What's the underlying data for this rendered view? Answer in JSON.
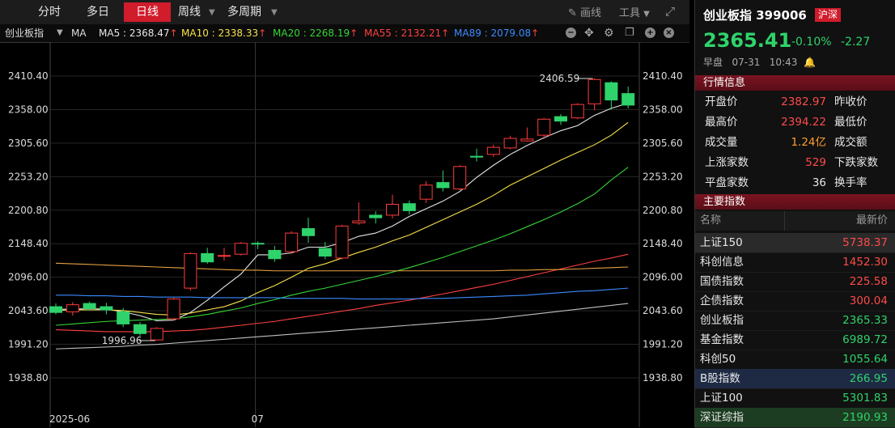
{
  "tabs": [
    {
      "label": "分时",
      "active": false,
      "caret": false
    },
    {
      "label": "多日",
      "active": false,
      "caret": false
    },
    {
      "label": "日线",
      "active": true,
      "caret": false
    },
    {
      "label": "周线",
      "active": false,
      "caret": true
    },
    {
      "label": "多周期",
      "active": false,
      "caret": true
    }
  ],
  "tools": {
    "draw": "画线",
    "tools": "工具"
  },
  "ma_bar": {
    "name": "创业板指",
    "ma": "MA",
    "items": [
      {
        "text": "MA5 : 2368.47",
        "color": "#e6e6e6"
      },
      {
        "text": "MA10 : 2338.33",
        "color": "#f5e04a"
      },
      {
        "text": "MA20 : 2268.19",
        "color": "#35d535"
      },
      {
        "text": "MA55 : 2132.21",
        "color": "#ff4040"
      },
      {
        "text": "MA89 : 2079.08",
        "color": "#3b8bff"
      }
    ],
    "arrow": "↑"
  },
  "chart_data": {
    "type": "candlestick",
    "y_ticks": [
      2410.4,
      2358.0,
      2305.6,
      2253.2,
      2200.8,
      2148.4,
      2096.0,
      2043.6,
      1991.2,
      1938.8
    ],
    "x_labels": [
      {
        "label": "2025-06",
        "index": 0
      },
      {
        "label": "07",
        "index": 12
      }
    ],
    "annotations": {
      "high": "2406.59",
      "low": "1996.96"
    },
    "candles": [
      {
        "o": 2050,
        "h": 2055,
        "l": 2038,
        "c": 2041
      },
      {
        "o": 2042,
        "h": 2057,
        "l": 2036,
        "c": 2053
      },
      {
        "o": 2055,
        "h": 2058,
        "l": 2044,
        "c": 2047
      },
      {
        "o": 2050,
        "h": 2056,
        "l": 2038,
        "c": 2045
      },
      {
        "o": 2042,
        "h": 2048,
        "l": 2018,
        "c": 2023
      },
      {
        "o": 2022,
        "h": 2026,
        "l": 2004,
        "c": 2008
      },
      {
        "o": 1998,
        "h": 2018,
        "l": 1997,
        "c": 2016
      },
      {
        "o": 2031,
        "h": 2064,
        "l": 2028,
        "c": 2062
      },
      {
        "o": 2079,
        "h": 2135,
        "l": 2075,
        "c": 2133
      },
      {
        "o": 2133,
        "h": 2142,
        "l": 2117,
        "c": 2120
      },
      {
        "o": 2129,
        "h": 2142,
        "l": 2122,
        "c": 2130
      },
      {
        "o": 2132,
        "h": 2151,
        "l": 2130,
        "c": 2149
      },
      {
        "o": 2149,
        "h": 2152,
        "l": 2140,
        "c": 2148
      },
      {
        "o": 2138,
        "h": 2145,
        "l": 2120,
        "c": 2125
      },
      {
        "o": 2136,
        "h": 2168,
        "l": 2133,
        "c": 2165
      },
      {
        "o": 2172,
        "h": 2189,
        "l": 2150,
        "c": 2161
      },
      {
        "o": 2141,
        "h": 2151,
        "l": 2124,
        "c": 2129
      },
      {
        "o": 2126,
        "h": 2178,
        "l": 2124,
        "c": 2176
      },
      {
        "o": 2181,
        "h": 2213,
        "l": 2178,
        "c": 2184
      },
      {
        "o": 2193,
        "h": 2199,
        "l": 2180,
        "c": 2189
      },
      {
        "o": 2193,
        "h": 2225,
        "l": 2188,
        "c": 2210
      },
      {
        "o": 2211,
        "h": 2216,
        "l": 2194,
        "c": 2200
      },
      {
        "o": 2218,
        "h": 2246,
        "l": 2212,
        "c": 2240
      },
      {
        "o": 2244,
        "h": 2263,
        "l": 2230,
        "c": 2236
      },
      {
        "o": 2234,
        "h": 2271,
        "l": 2232,
        "c": 2269
      },
      {
        "o": 2285,
        "h": 2297,
        "l": 2277,
        "c": 2284
      },
      {
        "o": 2288,
        "h": 2303,
        "l": 2284,
        "c": 2299
      },
      {
        "o": 2298,
        "h": 2317,
        "l": 2296,
        "c": 2313
      },
      {
        "o": 2309,
        "h": 2330,
        "l": 2308,
        "c": 2312
      },
      {
        "o": 2318,
        "h": 2345,
        "l": 2312,
        "c": 2343
      },
      {
        "o": 2347,
        "h": 2351,
        "l": 2334,
        "c": 2340
      },
      {
        "o": 2345,
        "h": 2368,
        "l": 2343,
        "c": 2366
      },
      {
        "o": 2367,
        "h": 2407,
        "l": 2357,
        "c": 2405
      },
      {
        "o": 2400,
        "h": 2402,
        "l": 2358,
        "c": 2373
      },
      {
        "o": 2383,
        "h": 2394,
        "l": 2360,
        "c": 2365
      }
    ],
    "ma_series": [
      {
        "name": "MA5",
        "color": "#e6e6e6",
        "values": [
          2046,
          2046,
          2047,
          2046,
          2042,
          2036,
          2028,
          2029,
          2041,
          2060,
          2081,
          2101,
          2131,
          2131,
          2134,
          2143,
          2143,
          2150,
          2160,
          2165,
          2176,
          2191,
          2203,
          2215,
          2230,
          2252,
          2271,
          2288,
          2302,
          2314,
          2325,
          2333,
          2349,
          2360,
          2368
        ]
      },
      {
        "name": "MA10",
        "color": "#f5e04a",
        "values": [
          2044,
          2045,
          2045,
          2045,
          2044,
          2041,
          2038,
          2037,
          2040,
          2045,
          2050,
          2059,
          2072,
          2083,
          2096,
          2110,
          2117,
          2126,
          2135,
          2143,
          2153,
          2162,
          2174,
          2186,
          2198,
          2210,
          2224,
          2240,
          2253,
          2266,
          2279,
          2291,
          2303,
          2318,
          2338
        ]
      },
      {
        "name": "MA20",
        "color": "#35d535",
        "values": [
          2021,
          2023,
          2025,
          2027,
          2028,
          2029,
          2030,
          2031,
          2034,
          2038,
          2043,
          2048,
          2055,
          2061,
          2068,
          2074,
          2079,
          2085,
          2091,
          2097,
          2104,
          2111,
          2119,
          2127,
          2136,
          2145,
          2154,
          2164,
          2175,
          2186,
          2198,
          2211,
          2226,
          2248,
          2268
        ]
      },
      {
        "name": "MA55",
        "color": "#ff4040",
        "values": [
          2014,
          2013,
          2012,
          2011,
          2011,
          2011,
          2011,
          2012,
          2013,
          2015,
          2018,
          2021,
          2024,
          2027,
          2031,
          2035,
          2039,
          2043,
          2047,
          2052,
          2056,
          2060,
          2065,
          2070,
          2075,
          2080,
          2085,
          2091,
          2097,
          2103,
          2109,
          2115,
          2121,
          2126,
          2132
        ]
      },
      {
        "name": "MA89",
        "color": "#3b8bff",
        "values": [
          2068,
          2068,
          2067,
          2067,
          2066,
          2066,
          2065,
          2065,
          2065,
          2064,
          2064,
          2064,
          2064,
          2064,
          2063,
          2063,
          2063,
          2063,
          2062,
          2062,
          2062,
          2062,
          2063,
          2063,
          2064,
          2065,
          2066,
          2067,
          2068,
          2070,
          2072,
          2074,
          2075,
          2077,
          2079
        ]
      },
      {
        "name": "",
        "color": "#e6a040",
        "values": [
          2118,
          2117,
          2116,
          2115,
          2114,
          2113,
          2112,
          2111,
          2110,
          2109,
          2108,
          2107,
          2107,
          2106,
          2106,
          2106,
          2106,
          2106,
          2106,
          2106,
          2106,
          2106,
          2106,
          2106,
          2106,
          2106,
          2106,
          2107,
          2107,
          2108,
          2108,
          2109,
          2110,
          2111,
          2112
        ]
      },
      {
        "name": "",
        "color": "#bfbfbf",
        "values": [
          1984,
          1985,
          1986,
          1987,
          1988,
          1990,
          1991,
          1993,
          1995,
          1997,
          1999,
          2001,
          2003,
          2005,
          2007,
          2009,
          2011,
          2013,
          2015,
          2017,
          2019,
          2021,
          2023,
          2025,
          2027,
          2029,
          2031,
          2034,
          2037,
          2040,
          2043,
          2046,
          2049,
          2052,
          2055
        ]
      }
    ]
  },
  "quote": {
    "title": "创业板指 399006",
    "market": "沪深",
    "price": "2365.41",
    "change_pct": "-0.10%",
    "change": "-2.27",
    "session": "早盘",
    "date": "07-31",
    "time": "10:43"
  },
  "sections": {
    "quote": "行情信息",
    "index": "主要指数"
  },
  "quote_rows": [
    {
      "l1": "开盘价",
      "v1": "2382.97",
      "c1": "red",
      "l2": "昨收价"
    },
    {
      "l1": "最高价",
      "v1": "2394.22",
      "c1": "red",
      "l2": "最低价"
    },
    {
      "l1": "成交量",
      "v1": "1.24亿",
      "c1": "orange",
      "l2": "成交额"
    },
    {
      "l1": "上涨家数",
      "v1": "529",
      "c1": "red",
      "l2": "下跌家数"
    },
    {
      "l1": "平盘家数",
      "v1": "36",
      "c1": "white",
      "l2": "换手率"
    }
  ],
  "index_header": {
    "name": "名称",
    "value": "最新价"
  },
  "index_rows": [
    {
      "name": "上证150",
      "value": "5738.37",
      "color": "red",
      "highlight": "#2a2a2a"
    },
    {
      "name": "科创信息",
      "value": "1452.30",
      "color": "red",
      "highlight": ""
    },
    {
      "name": "国债指数",
      "value": "225.58",
      "color": "red",
      "highlight": ""
    },
    {
      "name": "企债指数",
      "value": "300.04",
      "color": "red",
      "highlight": ""
    },
    {
      "name": "创业板指",
      "value": "2365.33",
      "color": "green",
      "highlight": ""
    },
    {
      "name": "基金指数",
      "value": "6989.72",
      "color": "green",
      "highlight": ""
    },
    {
      "name": "科创50",
      "value": "1055.64",
      "color": "green",
      "highlight": ""
    },
    {
      "name": "B股指数",
      "value": "266.95",
      "color": "green",
      "highlight": "#1e2a44"
    },
    {
      "name": "上证100",
      "value": "5301.83",
      "color": "green",
      "highlight": ""
    },
    {
      "name": "深证综指",
      "value": "2190.93",
      "color": "green",
      "highlight": "#1d3d22"
    }
  ]
}
